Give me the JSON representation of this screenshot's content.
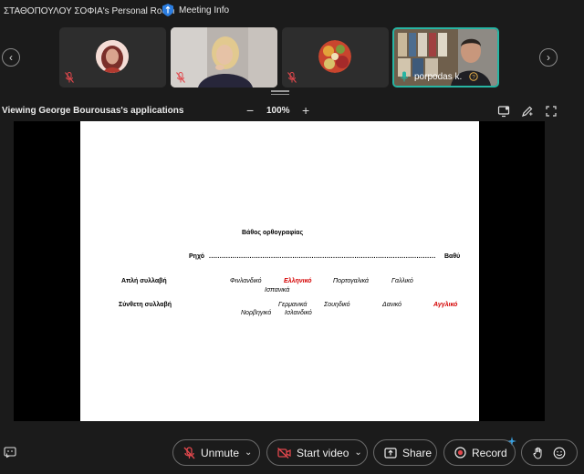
{
  "topbar": {
    "room_title": "ΣΤΑΘΟΠΟΥΛΟΥ ΣΟΦΙΑ's Personal Room",
    "meeting_info": "Meeting Info"
  },
  "participants": [
    {
      "name": ""
    },
    {
      "name": ""
    },
    {
      "name": ""
    },
    {
      "name": "porpodas k."
    }
  ],
  "viewbar": {
    "viewing": "Viewing George Bourousas's applications",
    "zoom_minus": "−",
    "zoom": "100%",
    "zoom_plus": "+"
  },
  "slide": {
    "title": "Βάθος ορθογραφίας",
    "left_label": "Ρηχό",
    "dots": "..........................................................................................................",
    "right_label": "Βαθύ",
    "row1_label": "Απλή  συλλαβή",
    "row2_label": "Σύνθετη συλλαβή",
    "row1_items": [
      "Φινλανδικό",
      "Ελληνικό",
      "Πορτογαλικά",
      "Γαλλικό",
      "Ισπανικά"
    ],
    "row2_items": [
      "Γερμανικά",
      "Σουηδικό",
      "Δανικό",
      "Αγγλικό",
      "Νορβηγικό",
      "Ισλανδικό"
    ]
  },
  "controls": {
    "unmute": "Unmute",
    "start_video": "Start video",
    "share": "Share",
    "record": "Record"
  },
  "colors": {
    "accent_teal": "#27b5a3",
    "mute_red": "#e0474c",
    "slide_red": "#d40000"
  }
}
